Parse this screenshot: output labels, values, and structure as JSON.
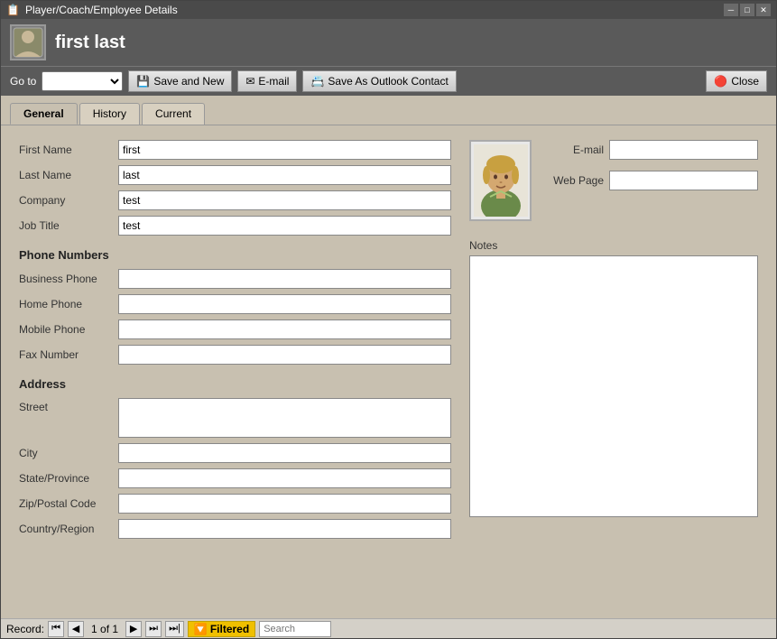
{
  "titleBar": {
    "title": "Player/Coach/Employee Details",
    "icon": "📋",
    "controls": [
      "min",
      "max",
      "close"
    ]
  },
  "header": {
    "title": "first last",
    "icon": "👤"
  },
  "toolbar": {
    "gotoLabel": "Go to",
    "gotoOptions": [
      ""
    ],
    "saveAndNewLabel": "Save and New",
    "emailLabel": "E-mail",
    "saveAsOutlookLabel": "Save As Outlook Contact",
    "closeLabel": "Close"
  },
  "tabs": [
    {
      "id": "general",
      "label": "General",
      "active": true
    },
    {
      "id": "history",
      "label": "History",
      "active": false
    },
    {
      "id": "current",
      "label": "Current",
      "active": false
    }
  ],
  "form": {
    "fields": {
      "firstName": {
        "label": "First Name",
        "value": "first"
      },
      "lastName": {
        "label": "Last Name",
        "value": "last"
      },
      "company": {
        "label": "Company",
        "value": "test"
      },
      "jobTitle": {
        "label": "Job Title",
        "value": "test"
      }
    },
    "phoneSection": {
      "title": "Phone Numbers",
      "fields": {
        "businessPhone": {
          "label": "Business Phone",
          "value": ""
        },
        "homePhone": {
          "label": "Home Phone",
          "value": ""
        },
        "mobilePhone": {
          "label": "Mobile Phone",
          "value": ""
        },
        "faxNumber": {
          "label": "Fax Number",
          "value": ""
        }
      }
    },
    "addressSection": {
      "title": "Address",
      "fields": {
        "street": {
          "label": "Street",
          "value": ""
        },
        "city": {
          "label": "City",
          "value": ""
        },
        "stateProvince": {
          "label": "State/Province",
          "value": ""
        },
        "zipPostal": {
          "label": "Zip/Postal Code",
          "value": ""
        },
        "countryRegion": {
          "label": "Country/Region",
          "value": ""
        }
      }
    },
    "rightSection": {
      "emailLabel": "E-mail",
      "emailValue": "",
      "webPageLabel": "Web Page",
      "webPageValue": "",
      "notesLabel": "Notes",
      "notesValue": ""
    }
  },
  "statusBar": {
    "recordLabel": "Record:",
    "firstBtn": "⏮",
    "prevBtn": "◀",
    "recordText": "1 of 1",
    "nextBtn": "▶",
    "lastBtn": "⏭",
    "newBtn": "⏭|",
    "filteredLabel": "Filtered",
    "searchPlaceholder": "Search"
  }
}
